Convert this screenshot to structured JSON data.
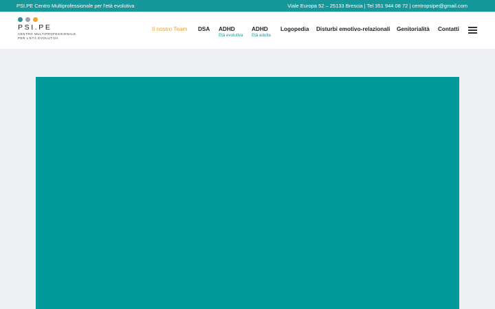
{
  "topbar": {
    "left_text": "PSI.PE Centro Multiprofessionale per l'età evolutiva",
    "right_text": "Viale Europa 52 – 25133 Brescia | Tel 351 944 08 72  | centropsipe@gmail.com",
    "bg_color": "#16989b"
  },
  "logo": {
    "dot_colors": [
      "#2c8f93",
      "#9aa3ab",
      "#f0a233"
    ],
    "name": "PSI.PE",
    "subtitle_line1": "CENTRO MULTIPROFESSIONALE",
    "subtitle_line2": "PER L'ETÀ EVOLUTIVA"
  },
  "nav": {
    "items": [
      {
        "label": "Il nostro Team",
        "sub": "",
        "active": true
      },
      {
        "label": "DSA",
        "sub": ""
      },
      {
        "label": "ADHD",
        "sub": "Età evolutiva"
      },
      {
        "label": "ADHD",
        "sub": "Età adulta"
      },
      {
        "label": "Logopedia",
        "sub": ""
      },
      {
        "label": "Disturbi emotivo-relazionali",
        "sub": ""
      },
      {
        "label": "Genitorialità",
        "sub": ""
      },
      {
        "label": "Contatti",
        "sub": ""
      }
    ],
    "menu_icon": "hamburger-menu-icon",
    "active_color": "#f0a233",
    "sub_color": "#16989b"
  },
  "hero": {
    "bg_color": "#00989b"
  }
}
